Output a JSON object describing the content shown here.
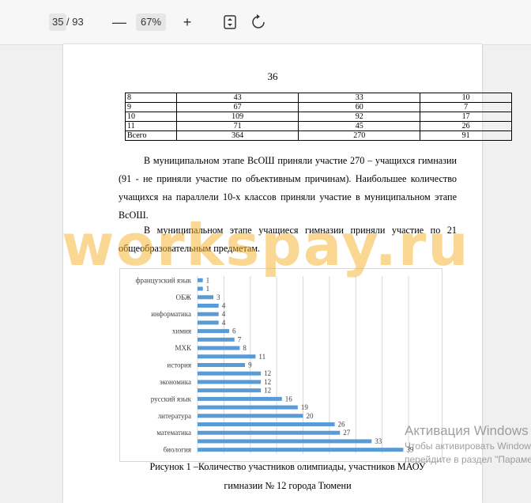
{
  "toolbar": {
    "current_page": "35",
    "separator": "/",
    "total_pages": "93",
    "zoom_out_label": "—",
    "zoom_level": "67%",
    "zoom_in_label": "+"
  },
  "document": {
    "page_number": "36",
    "table_rows": [
      [
        "8",
        "43",
        "33",
        "10"
      ],
      [
        "9",
        "67",
        "60",
        "7"
      ],
      [
        "10",
        "109",
        "92",
        "17"
      ],
      [
        "11",
        "71",
        "45",
        "26"
      ],
      [
        "Всего",
        "364",
        "270",
        "91"
      ]
    ],
    "paragraph_1": "В муниципальном этапе ВсОШ приняли участие 270 – учащихся гимназии (91 - не приняли участие по объективным причинам). Наибольшее количество учащихся на параллели 10-х классов приняли участие в муниципальном этапе ВсОШ.",
    "paragraph_2": "В муниципальном этапе учащиеся гимназии приняли участие по 21 общеобразовательным предметам.",
    "caption_line1": "Рисунок 1 –Количество участников олимпиады, участников МАОУ",
    "caption_line2": "гимназии № 12 города Тюмени"
  },
  "chart_data": {
    "type": "bar",
    "orientation": "horizontal",
    "values": [
      1,
      1,
      3,
      4,
      4,
      4,
      6,
      7,
      8,
      11,
      9,
      12,
      12,
      12,
      16,
      19,
      20,
      26,
      27,
      33,
      39
    ],
    "labels": [
      "французский язык",
      "",
      "ОБЖ",
      "",
      "информатика",
      "",
      "химия",
      "",
      "МХК",
      "",
      "история",
      "",
      "экономика",
      "",
      "русский язык",
      "",
      "литература",
      "",
      "математика",
      "",
      "биология"
    ],
    "xlim": [
      0,
      40
    ],
    "grid": true,
    "bar_color": "#5b9bd5"
  },
  "watermark_text": "workspay.ru",
  "activation": {
    "line1": "Активация Windows",
    "line2": "Чтобы активировать Windows,",
    "line3": "перейдите в раздел \"Параметры\"."
  }
}
